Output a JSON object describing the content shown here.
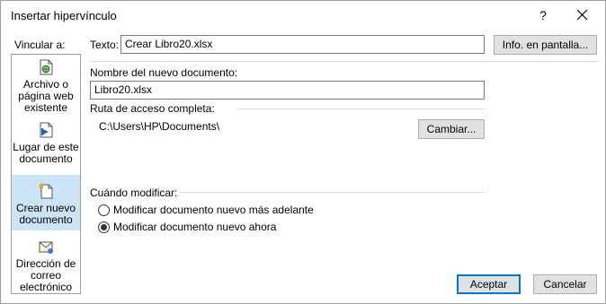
{
  "dialog": {
    "title": "Insertar hipervínculo",
    "help_label": "?"
  },
  "sidebar": {
    "heading": "Vincular a:",
    "items": [
      {
        "line1": "Archivo o",
        "line2": "página web",
        "line3": "existente",
        "icon": "web-page-icon"
      },
      {
        "line1": "Lugar de este",
        "line2": "documento",
        "icon": "place-in-document-icon"
      },
      {
        "line1": "Crear nuevo",
        "line2": "documento",
        "icon": "new-document-icon"
      },
      {
        "line1": "Dirección de",
        "line2": "correo",
        "line3": "electrónico",
        "icon": "email-icon"
      }
    ],
    "selected_index": 2
  },
  "text_field": {
    "label": "Texto:",
    "value": "Crear Libro20.xlsx"
  },
  "screen_tip_button": "Info. en pantalla...",
  "new_doc": {
    "label": "Nombre del nuevo documento:",
    "value": "Libro20.xlsx"
  },
  "path": {
    "label": "Ruta de acceso completa:",
    "value": "C:\\Users\\HP\\Documents\\",
    "change_button": "Cambiar..."
  },
  "when_edit": {
    "label": "Cuándo modificar:",
    "options": [
      {
        "label": "Modificar documento nuevo más adelante",
        "selected": false
      },
      {
        "label": "Modificar documento nuevo ahora",
        "selected": true
      }
    ]
  },
  "footer": {
    "ok": "Aceptar",
    "cancel": "Cancelar"
  },
  "colors": {
    "selected_bg": "#cce4f7",
    "default_button_border": "#0078d7"
  }
}
